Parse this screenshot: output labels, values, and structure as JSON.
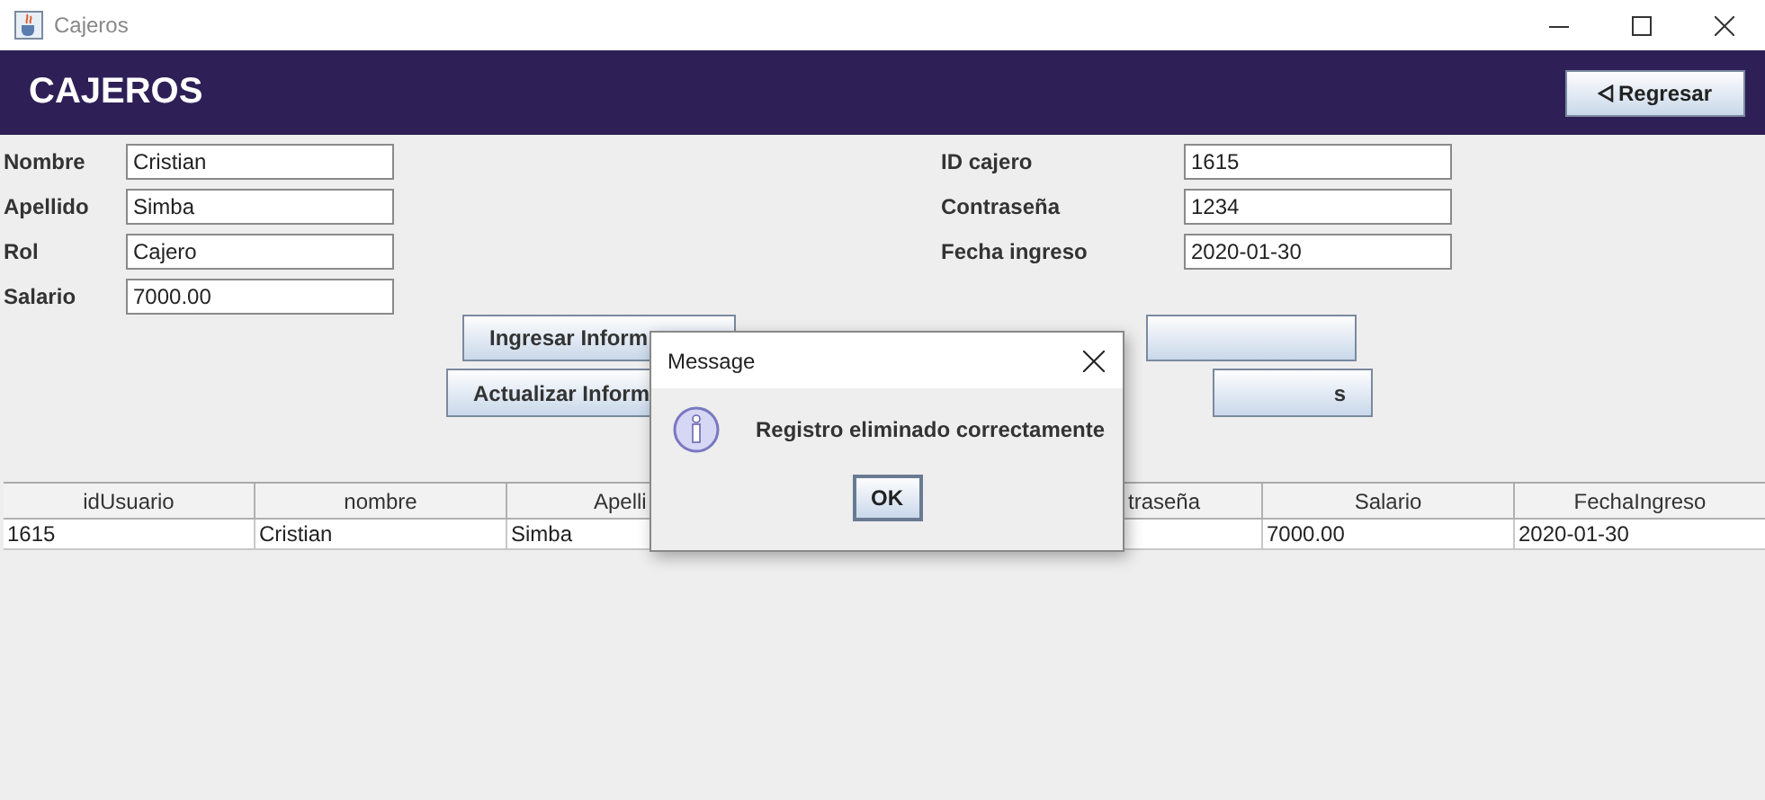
{
  "window": {
    "title": "Cajeros"
  },
  "header": {
    "title": "CAJEROS",
    "back_button": "Regresar"
  },
  "form_left": [
    {
      "label": "Nombre",
      "value": "Cristian"
    },
    {
      "label": "Apellido",
      "value": "Simba"
    },
    {
      "label": "Rol",
      "value": "Cajero"
    },
    {
      "label": "Salario",
      "value": "7000.00"
    }
  ],
  "form_right": [
    {
      "label": "ID cajero",
      "value": "1615"
    },
    {
      "label": "Contraseña",
      "value": "1234"
    },
    {
      "label": "Fecha ingreso",
      "value": "2020-01-30"
    }
  ],
  "buttons": [
    {
      "text": "Ingresar Inform"
    },
    {
      "text": "Actualizar Inform"
    },
    {
      "text": "s"
    }
  ],
  "table": {
    "columns": [
      {
        "label": "idUsuario"
      },
      {
        "label": "nombre"
      },
      {
        "label": "Apelli"
      },
      {},
      {
        "label": "traseña"
      },
      {
        "label": "Salario"
      },
      {
        "label": "FechaIngreso"
      }
    ],
    "rows": [
      [
        {
          "text": "1615"
        },
        {
          "text": "Cristian"
        },
        {
          "text": "Simba"
        },
        {},
        {},
        {
          "text": "7000.00"
        },
        {
          "text": "2020-01-30"
        }
      ]
    ]
  },
  "dialog": {
    "title": "Message",
    "message": "Registro eliminado correctamente",
    "button": "OK"
  }
}
